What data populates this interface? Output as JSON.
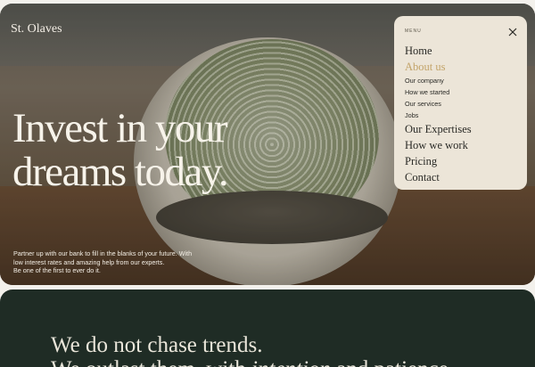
{
  "brand": {
    "name": "St. Olaves"
  },
  "hero": {
    "headline_line1": "Invest in your",
    "headline_line2": "dreams today.",
    "intro_line1": "Partner up with our bank to fill in the blanks of your future. With",
    "intro_line2": "low interest rates and amazing help from our experts.",
    "intro_line3": "Be one of the first to ever do it.",
    "background_image": "cactus-in-pot-photo"
  },
  "menu": {
    "label": "MENU",
    "close_icon": "close-icon",
    "items": [
      {
        "label": "Home",
        "level": "main",
        "active": false
      },
      {
        "label": "About us",
        "level": "main",
        "active": true
      },
      {
        "label": "Our company",
        "level": "sub",
        "active": false
      },
      {
        "label": "How we started",
        "level": "sub",
        "active": false
      },
      {
        "label": "Our services",
        "level": "sub",
        "active": false
      },
      {
        "label": "Jobs",
        "level": "sub",
        "active": false
      },
      {
        "label": "Our Expertises",
        "level": "main",
        "active": false
      },
      {
        "label": "How we work",
        "level": "main",
        "active": false
      },
      {
        "label": "Pricing",
        "level": "main",
        "active": false
      },
      {
        "label": "Contact",
        "level": "main",
        "active": false
      }
    ],
    "active_color": "#c3a46a"
  },
  "statement": {
    "line1": "We do not chase trends.",
    "line2_start": "We outlast them, with ",
    "line2_italic": "intention",
    "line2_end": " and patience."
  },
  "colors": {
    "menu_bg": "#ece5d8",
    "dark_section_bg": "#1f2c25",
    "hero_text": "#f7f3ea"
  }
}
